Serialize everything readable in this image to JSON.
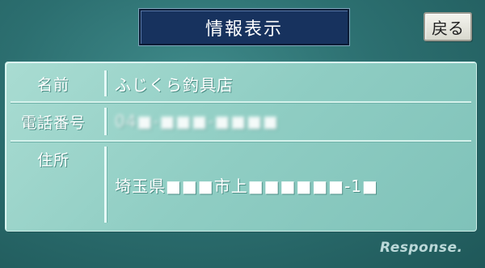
{
  "header": {
    "title": "情報表示",
    "back_label": "戻る"
  },
  "info": {
    "name_label": "名前",
    "name_value": "ふじくら釣具店",
    "phone_label": "電話番号",
    "phone_value": "04■-■■■-■■■■",
    "address_label": "住所",
    "address_value": "埼玉県■■■市上■■■■■■-1■"
  },
  "watermark": "Response."
}
